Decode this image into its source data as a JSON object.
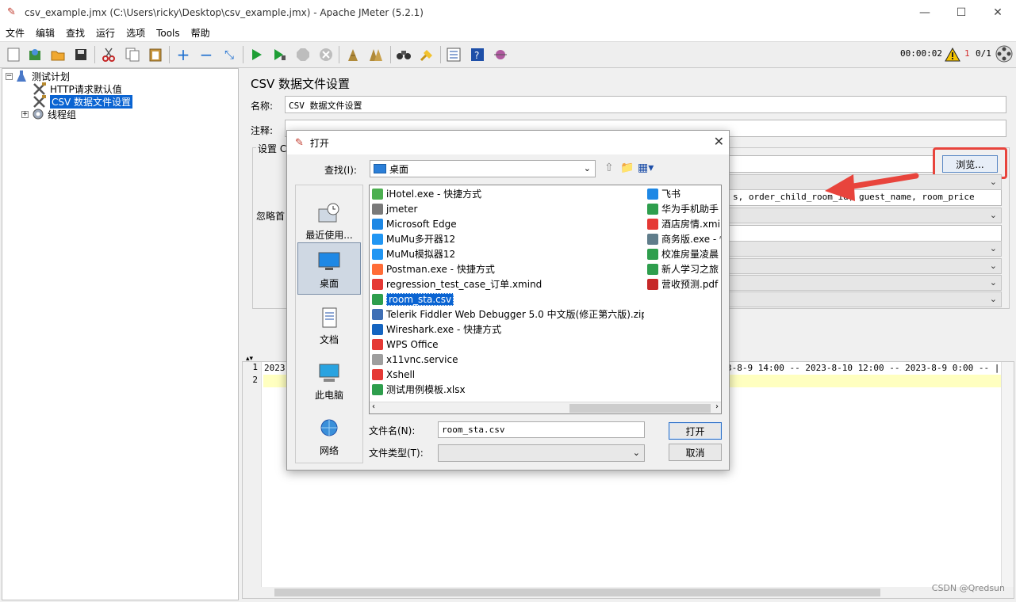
{
  "window": {
    "title": "csv_example.jmx (C:\\Users\\ricky\\Desktop\\csv_example.jmx) - Apache JMeter (5.2.1)",
    "minimize_glyph": "—",
    "maximize_glyph": "☐",
    "close_glyph": "✕"
  },
  "menu": [
    "文件",
    "编辑",
    "查找",
    "运行",
    "选项",
    "Tools",
    "帮助"
  ],
  "toolbar": {
    "timer": "00:00:02",
    "warning_count": "1",
    "threads": "0/1"
  },
  "tree": {
    "root": "测试计划",
    "items": [
      "HTTP请求默认值",
      "CSV 数据文件设置",
      "线程组"
    ]
  },
  "panel": {
    "title": "CSV 数据文件设置",
    "name_label": "名称:",
    "name_value": "CSV 数据文件设置",
    "comment_label": "注释:",
    "settings_label": "设置 C",
    "ignore_label": "忽略首",
    "browse_button": "浏览...",
    "variable_names": "s, order_child_room_id, guest_name, room_price"
  },
  "editor": {
    "line_numbers": [
      "1",
      "2"
    ],
    "line1_start": "2023",
    "line1_end": "3-8-9 14:00 -- 2023-8-10 12:00 -- 2023-8-9 0:00 -- |"
  },
  "watermark": "CSDN @Qredsun",
  "dialog": {
    "title": "打开",
    "look_in_label": "查找(I):",
    "look_in_value": "桌面",
    "places": [
      {
        "label": "最近使用..."
      },
      {
        "label": "桌面"
      },
      {
        "label": "文档"
      },
      {
        "label": "此电脑"
      },
      {
        "label": "网络"
      }
    ],
    "files_col1": [
      {
        "name": "iHotel.exe - 快捷方式",
        "icon": "shortcut-icon",
        "color": "#4caf50"
      },
      {
        "name": "jmeter",
        "icon": "file-icon",
        "color": "#7a7a7a"
      },
      {
        "name": "Microsoft Edge",
        "icon": "edge-icon",
        "color": "#1e88e5"
      },
      {
        "name": "MuMu多开器12",
        "icon": "mumu-icon",
        "color": "#2196f3"
      },
      {
        "name": "MuMu模拟器12",
        "icon": "mumu-icon",
        "color": "#2196f3"
      },
      {
        "name": "Postman.exe - 快捷方式",
        "icon": "postman-icon",
        "color": "#ff6c37"
      },
      {
        "name": "regression_test_case_订单.xmind",
        "icon": "xmind-icon",
        "color": "#e53935"
      },
      {
        "name": "room_sta.csv",
        "icon": "csv-icon",
        "color": "#2e9e4d"
      },
      {
        "name": "Telerik Fiddler Web Debugger 5.0 中文版(修正第六版).zip",
        "icon": "zip-icon",
        "color": "#3f6fb5"
      },
      {
        "name": "Wireshark.exe - 快捷方式",
        "icon": "wireshark-icon",
        "color": "#1565c0"
      },
      {
        "name": "WPS Office",
        "icon": "wps-icon",
        "color": "#e53935"
      },
      {
        "name": "x11vnc.service",
        "icon": "file-icon",
        "color": "#9e9e9e"
      },
      {
        "name": "Xshell",
        "icon": "xshell-icon",
        "color": "#e53935"
      },
      {
        "name": "测试用例模板.xlsx",
        "icon": "xlsx-icon",
        "color": "#2e9e4d"
      }
    ],
    "files_col2": [
      {
        "name": "飞书",
        "icon": "feishu-icon",
        "color": "#1e88e5"
      },
      {
        "name": "华为手机助手",
        "icon": "huawei-icon",
        "color": "#2e9e4d"
      },
      {
        "name": "酒店房情.xmind",
        "icon": "xmind-icon",
        "color": "#e53935"
      },
      {
        "name": "商务版.exe - 快",
        "icon": "shortcut-icon",
        "color": "#607d8b"
      },
      {
        "name": "校准房量凌晨",
        "icon": "xlsx-icon",
        "color": "#2e9e4d"
      },
      {
        "name": "新人学习之旅",
        "icon": "xlsx-icon",
        "color": "#2e9e4d"
      },
      {
        "name": "营收预测.pdf",
        "icon": "pdf-icon",
        "color": "#c62828"
      }
    ],
    "filename_label": "文件名(N):",
    "filename_value": "room_sta.csv",
    "filetype_label": "文件类型(T):",
    "open_button": "打开",
    "cancel_button": "取消"
  },
  "colors": {
    "selection": "#0a64d2",
    "highlight": "#e8443c",
    "editor_line": "#ffffc0"
  }
}
